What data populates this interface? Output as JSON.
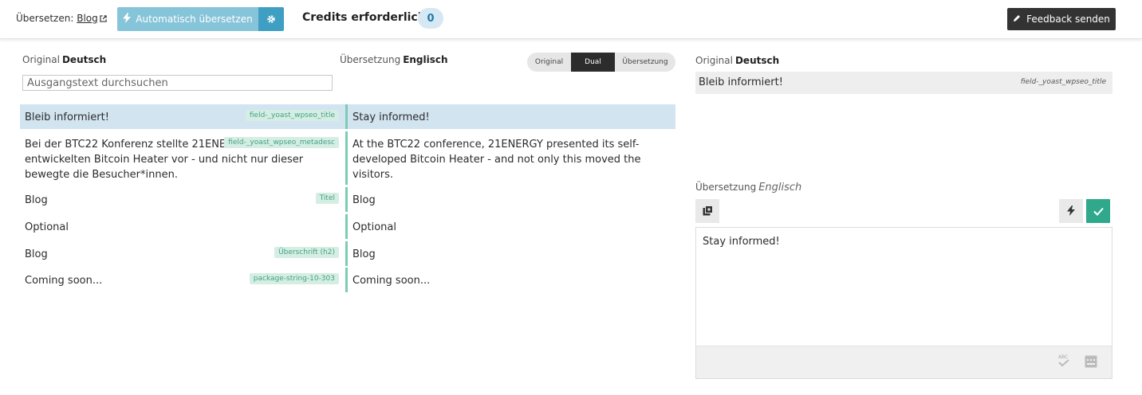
{
  "topbar": {
    "translate_prefix": "Übersetzen:",
    "translate_link": "Blog",
    "auto_translate_label": "Automatisch übersetzen",
    "credits_label": "Credits erforderlich",
    "credits_value": "0",
    "feedback_label": "Feedback senden"
  },
  "left_panel": {
    "original_label": "Original",
    "original_lang": "Deutsch",
    "translation_label": "Übersetzung",
    "translation_lang": "Englisch",
    "search_placeholder": "Ausgangstext durchsuchen",
    "view_options": [
      "Original",
      "Dual",
      "Übersetzung"
    ],
    "view_selected": "Dual",
    "rows": [
      {
        "source": "Bleib informiert!",
        "field": "field-_yoast_wpseo_title",
        "target": "Stay informed!",
        "selected": true
      },
      {
        "source": "Bei der BTC22 Konferenz stellte 21ENERGY den selbst entwickelten Bitcoin Heater vor - und nicht nur dieser bewegte die Besucher*innen.",
        "field": "field-_yoast_wpseo_metadesc",
        "target": "At the BTC22 conference, 21ENERGY presented its self-developed Bitcoin Heater - and not only this moved the visitors."
      },
      {
        "source": "Blog",
        "field": "Titel",
        "target": "Blog"
      },
      {
        "source": "Optional",
        "field": "",
        "target": "Optional"
      },
      {
        "source": "Blog",
        "field": "Überschrift (h2)",
        "target": "Blog"
      },
      {
        "source": "Coming soon...",
        "field": "package-string-10-303",
        "target": "Coming soon..."
      }
    ]
  },
  "right_panel": {
    "original_label": "Original",
    "original_lang": "Deutsch",
    "source_text": "Bleib informiert!",
    "source_field": "field-_yoast_wpseo_title",
    "translation_label": "Übersetzung",
    "translation_lang": "Englisch",
    "editor_text": "Stay informed!"
  },
  "colors": {
    "accent_blue": "#3f9fc2",
    "auto_button": "#86c4d9",
    "accent_green": "#2fa88b",
    "selected_row": "#d2e4f0",
    "dark_button": "#333333"
  },
  "icons": [
    "external-link-icon",
    "bolt-icon",
    "gear-icon",
    "pencil-icon",
    "copy-icon",
    "check-icon",
    "spellcheck-icon",
    "keyboard-icon"
  ]
}
